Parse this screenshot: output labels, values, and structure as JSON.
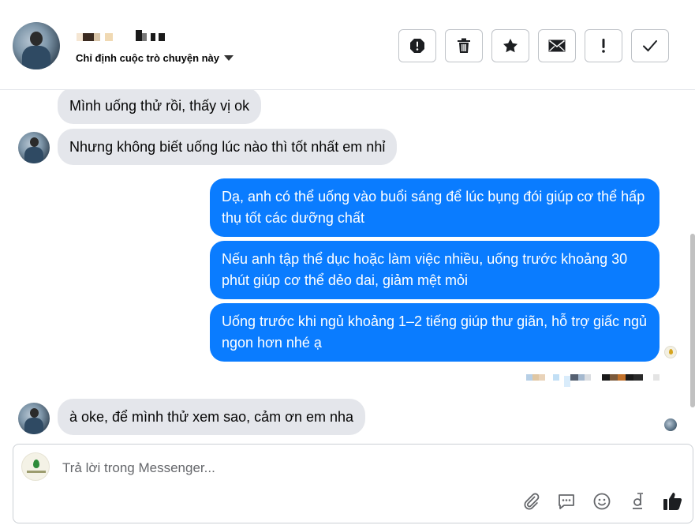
{
  "header": {
    "assign_label": "Chỉ định cuộc trò chuyện này",
    "toolbar": [
      {
        "name": "report-button",
        "icon": "alert-circle-icon"
      },
      {
        "name": "delete-button",
        "icon": "trash-icon"
      },
      {
        "name": "star-button",
        "icon": "star-icon"
      },
      {
        "name": "mark-unread-button",
        "icon": "envelope-icon"
      },
      {
        "name": "important-button",
        "icon": "exclamation-icon"
      },
      {
        "name": "done-button",
        "icon": "check-icon"
      }
    ]
  },
  "messages": {
    "m1": "Mình uống thử rồi, thấy vị ok",
    "m2": "Nhưng không biết uống lúc nào thì tốt nhất em nhỉ",
    "m3": "Dạ, anh có thể uống vào buổi sáng để lúc bụng đói giúp cơ thể hấp thụ tốt các dưỡng chất",
    "m4": "Nếu anh tập thể dục hoặc làm việc nhiều, uống trước khoảng 30 phút giúp cơ thể dẻo dai, giảm mệt mỏi",
    "m5": "Uống trước khi ngủ khoảng 1–2 tiếng giúp thư giãn, hỗ trợ giấc ngủ ngon hơn nhé ạ",
    "m6": "à oke, để mình thử xem sao, cảm ơn em nha"
  },
  "composer": {
    "placeholder": "Trả lời trong Messenger...",
    "tools": [
      "paperclip-icon",
      "saved-reply-icon",
      "emoji-icon",
      "dong-currency-icon",
      "thumbs-up-icon"
    ]
  },
  "colors": {
    "outgoing_bubble": "#0a7cff",
    "incoming_bubble": "#e4e6eb",
    "toolbar_border": "#bfc3c8"
  }
}
